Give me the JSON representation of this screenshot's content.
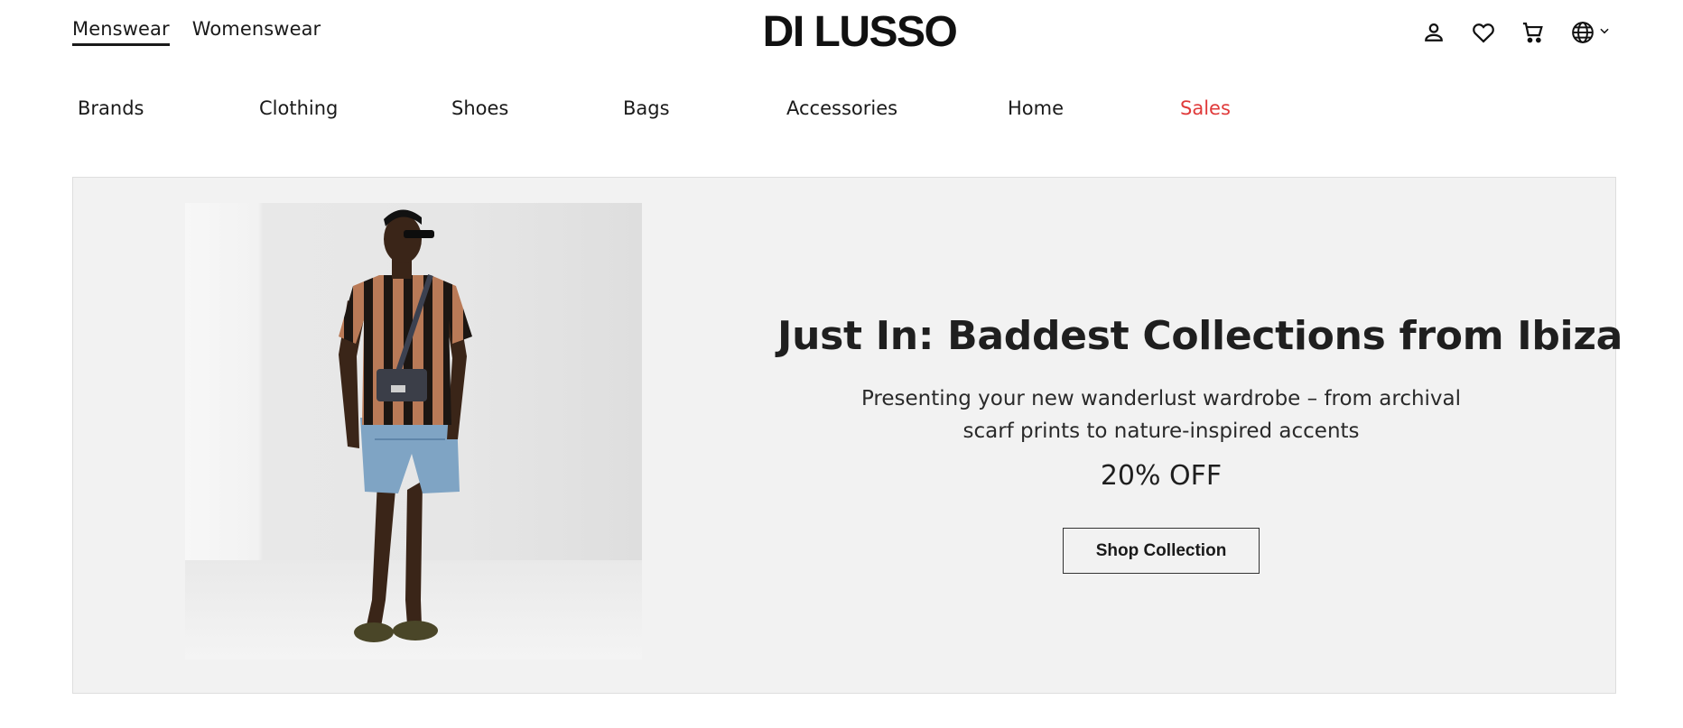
{
  "header": {
    "gender_tabs": [
      {
        "label": "Menswear",
        "active": true
      },
      {
        "label": "Womenswear",
        "active": false
      }
    ],
    "logo_text": "DI LUSSO",
    "icons": [
      "account-icon",
      "wishlist-heart-icon",
      "cart-icon",
      "globe-icon",
      "chevron-down-icon"
    ]
  },
  "nav": {
    "categories": [
      {
        "label": "Brands"
      },
      {
        "label": "Clothing"
      },
      {
        "label": "Shoes"
      },
      {
        "label": "Bags"
      },
      {
        "label": "Accessories"
      },
      {
        "label": "Home"
      },
      {
        "label": "Sales",
        "highlight": true
      }
    ],
    "sale_color": "#e03a3a"
  },
  "hero": {
    "title": "Just In: Baddest Collections from Ibiza",
    "subtitle": "Presenting your new wanderlust wardrobe – from archival scarf prints to nature-inspired accents",
    "discount": "20% OFF",
    "cta_label": "Shop Collection",
    "background_color": "#f2f2f2"
  }
}
